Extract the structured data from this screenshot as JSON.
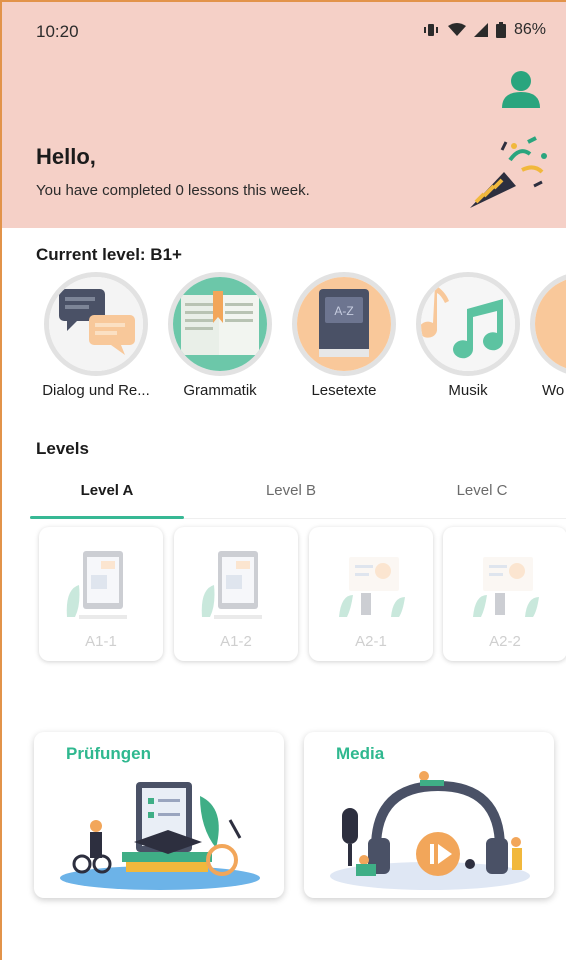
{
  "status_bar": {
    "time": "10:20",
    "battery": "86%"
  },
  "header": {
    "greeting": "Hello,",
    "subtitle": "You have completed 0 lessons this week."
  },
  "current_level": {
    "label": "Current level: B1+"
  },
  "categories": [
    {
      "label": "Dialog und Re...",
      "icon": "dialog-icon"
    },
    {
      "label": "Grammatik",
      "icon": "book-icon"
    },
    {
      "label": "Lesetexte",
      "icon": "dictionary-icon"
    },
    {
      "label": "Musik",
      "icon": "music-note-icon"
    },
    {
      "label": "Wo",
      "icon": "partial-icon"
    }
  ],
  "levels": {
    "title": "Levels",
    "tabs": [
      {
        "label": "Level A",
        "active": true
      },
      {
        "label": "Level B",
        "active": false
      },
      {
        "label": "Level C",
        "active": false
      }
    ],
    "cards": [
      {
        "label": "A1-1"
      },
      {
        "label": "A1-2"
      },
      {
        "label": "A2-1"
      },
      {
        "label": "A2-2"
      }
    ]
  },
  "features": [
    {
      "title": "Prüfungen"
    },
    {
      "title": "Media"
    }
  ],
  "colors": {
    "header_bg": "#f5d0c7",
    "accent": "#37b894",
    "feature_title": "#2fb88f",
    "frame_border": "#e2934a"
  }
}
